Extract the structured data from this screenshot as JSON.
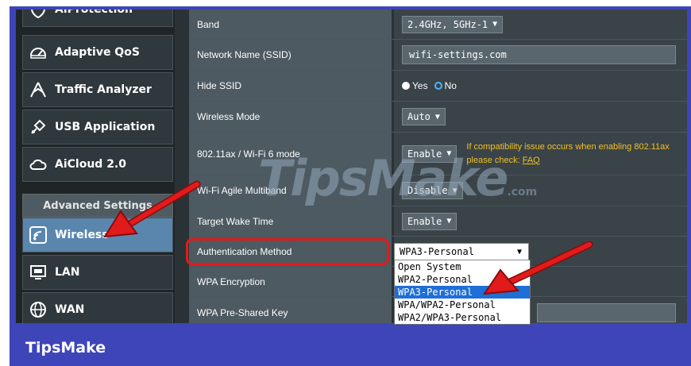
{
  "sidebar": {
    "items": [
      {
        "label": "AiProtection",
        "icon": "shield-icon"
      },
      {
        "label": "Adaptive QoS",
        "icon": "speedometer-icon"
      },
      {
        "label": "Traffic Analyzer",
        "icon": "analyzer-icon"
      },
      {
        "label": "USB Application",
        "icon": "puzzle-icon"
      },
      {
        "label": "AiCloud 2.0",
        "icon": "cloud-icon"
      }
    ],
    "advanced_header": "Advanced Settings",
    "advanced_items": [
      {
        "label": "Wireless",
        "icon": "wifi-icon",
        "active": true
      },
      {
        "label": "LAN",
        "icon": "monitor-icon"
      },
      {
        "label": "WAN",
        "icon": "globe-icon"
      }
    ]
  },
  "settings": {
    "band": {
      "label": "Band",
      "value": "2.4GHz, 5GHz-1"
    },
    "ssid": {
      "label": "Network Name (SSID)",
      "value": "wifi-settings.com"
    },
    "hide_ssid": {
      "label": "Hide SSID",
      "yes": "Yes",
      "no": "No",
      "selected": "Yes"
    },
    "wireless_mode": {
      "label": "Wireless Mode",
      "value": "Auto"
    },
    "ax_mode": {
      "label": "802.11ax / Wi-Fi 6 mode",
      "value": "Enable",
      "warning_line1": "If compatibility issue occurs when enabling 802.11ax",
      "warning_line2": "please check:",
      "faq": "FAQ"
    },
    "agile": {
      "label": "Wi-Fi Agile Multiband",
      "value": "Disable"
    },
    "twt": {
      "label": "Target Wake Time",
      "value": "Enable"
    },
    "auth": {
      "label": "Authentication Method",
      "value": "WPA3-Personal"
    },
    "wpa_enc": {
      "label": "WPA Encryption"
    },
    "psk": {
      "label": "WPA Pre-Shared Key"
    }
  },
  "auth_options": [
    "Open System",
    "WPA2-Personal",
    "WPA3-Personal",
    "WPA/WPA2-Personal",
    "WPA2/WPA3-Personal"
  ],
  "auth_highlight_index": 2,
  "watermark": {
    "text": "TipsMake",
    "suffix": ".com"
  },
  "brand": "TipsMake",
  "colors": {
    "frame": "#3d45b8",
    "highlight": "#1e6fd6",
    "warning": "#f2c022",
    "annotation_red": "#e11b1b"
  }
}
